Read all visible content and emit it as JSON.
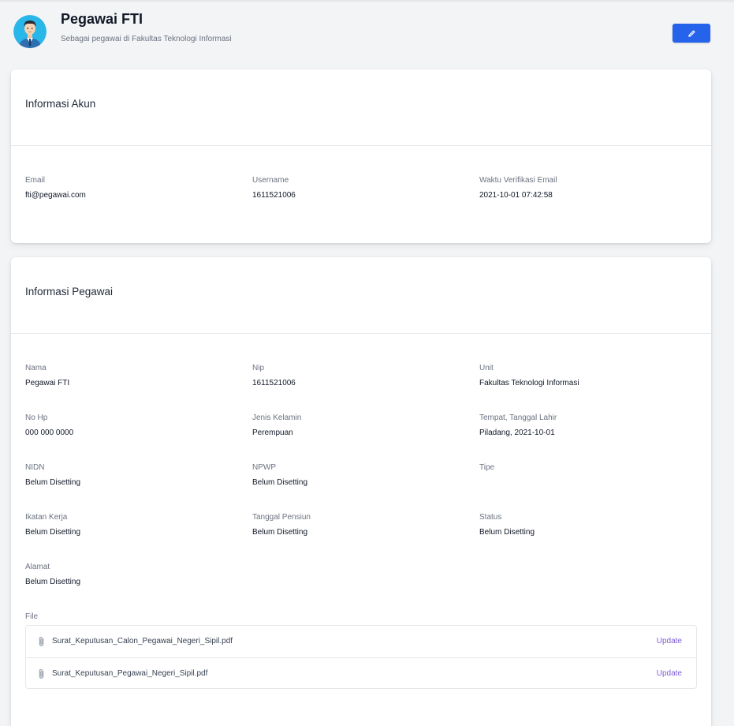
{
  "header": {
    "title": "Pegawai FTI",
    "subtitle": "Sebagai pegawai di Fakultas Teknologi Informasi",
    "edit_icon": "pencil-icon"
  },
  "akun": {
    "title": "Informasi Akun",
    "fields": [
      {
        "label": "Email",
        "value": "fti@pegawai.com"
      },
      {
        "label": "Username",
        "value": "1611521006"
      },
      {
        "label": "Waktu Verifikasi Email",
        "value": "2021-10-01 07:42:58"
      }
    ]
  },
  "pegawai": {
    "title": "Informasi Pegawai",
    "fields": [
      {
        "label": "Nama",
        "value": "Pegawai FTI"
      },
      {
        "label": "Nip",
        "value": "1611521006"
      },
      {
        "label": "Unit",
        "value": "Fakultas Teknologi Informasi"
      },
      {
        "label": "No Hp",
        "value": "000 000 0000"
      },
      {
        "label": "Jenis Kelamin",
        "value": "Perempuan"
      },
      {
        "label": "Tempat, Tanggal Lahir",
        "value": "Piladang, 2021-10-01"
      },
      {
        "label": "NIDN",
        "value": "Belum Disetting"
      },
      {
        "label": "NPWP",
        "value": "Belum Disetting"
      },
      {
        "label": "Tipe",
        "value": ""
      },
      {
        "label": "Ikatan Kerja",
        "value": "Belum Disetting"
      },
      {
        "label": "Tanggal Pensiun",
        "value": "Belum Disetting"
      },
      {
        "label": "Status",
        "value": "Belum Disetting"
      },
      {
        "label": "Alamat",
        "value": "Belum Disetting"
      }
    ],
    "file_label": "File",
    "files": [
      {
        "name": "Surat_Keputusan_Calon_Pegawai_Negeri_Sipil.pdf",
        "action": "Update"
      },
      {
        "name": "Surat_Keputusan_Pegawai_Negeri_Sipil.pdf",
        "action": "Update"
      }
    ]
  },
  "colors": {
    "primary": "#2563eb",
    "link": "#7c5bd6",
    "background": "#f3f4f6"
  }
}
